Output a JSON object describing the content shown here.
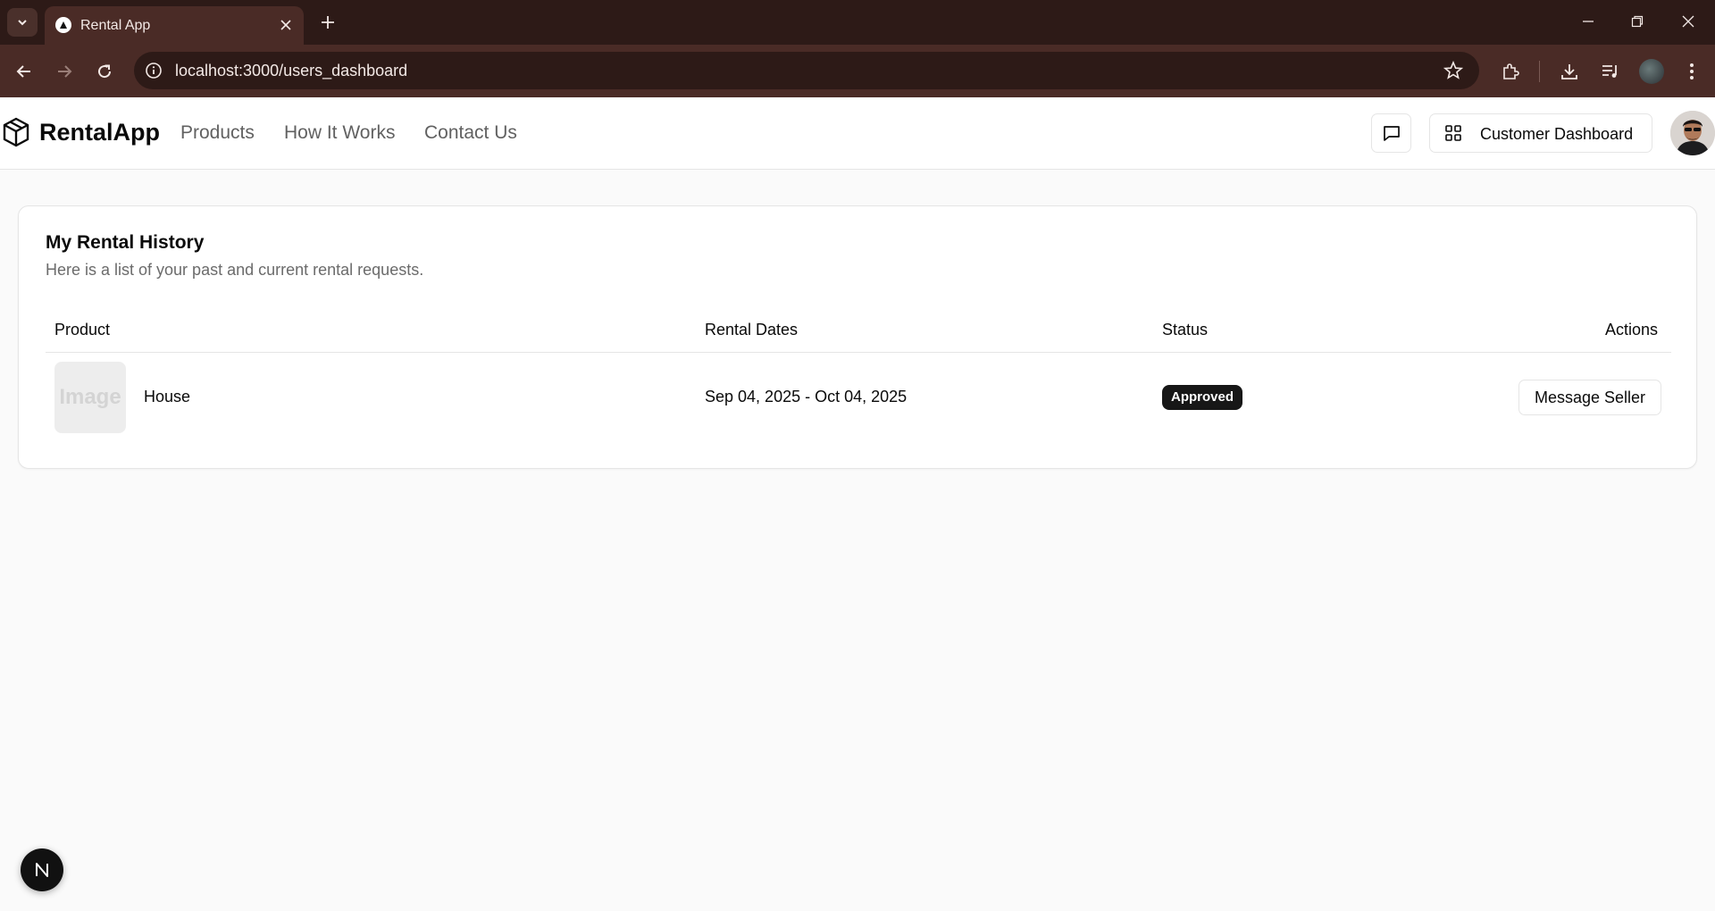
{
  "browser": {
    "tab_title": "Rental App",
    "url": "localhost:3000/users_dashboard"
  },
  "header": {
    "logo_text": "RentalApp",
    "nav": [
      {
        "label": "Products"
      },
      {
        "label": "How It Works"
      },
      {
        "label": "Contact Us"
      }
    ],
    "dashboard_label": "Customer Dashboard"
  },
  "card": {
    "title": "My Rental History",
    "description": "Here is a list of your past and current rental requests.",
    "columns": [
      "Product",
      "Rental Dates",
      "Status",
      "Actions"
    ],
    "rows": [
      {
        "image_placeholder": "Image",
        "product": "House",
        "dates": "Sep 04, 2025 - Oct 04, 2025",
        "status": "Approved",
        "action": "Message Seller"
      }
    ]
  },
  "dev_badge": "N",
  "colors": {
    "browser_frame": "#2d1a17",
    "browser_toolbar": "#4a2b26",
    "badge_bg": "#171717",
    "page_bg": "#fafafa"
  }
}
